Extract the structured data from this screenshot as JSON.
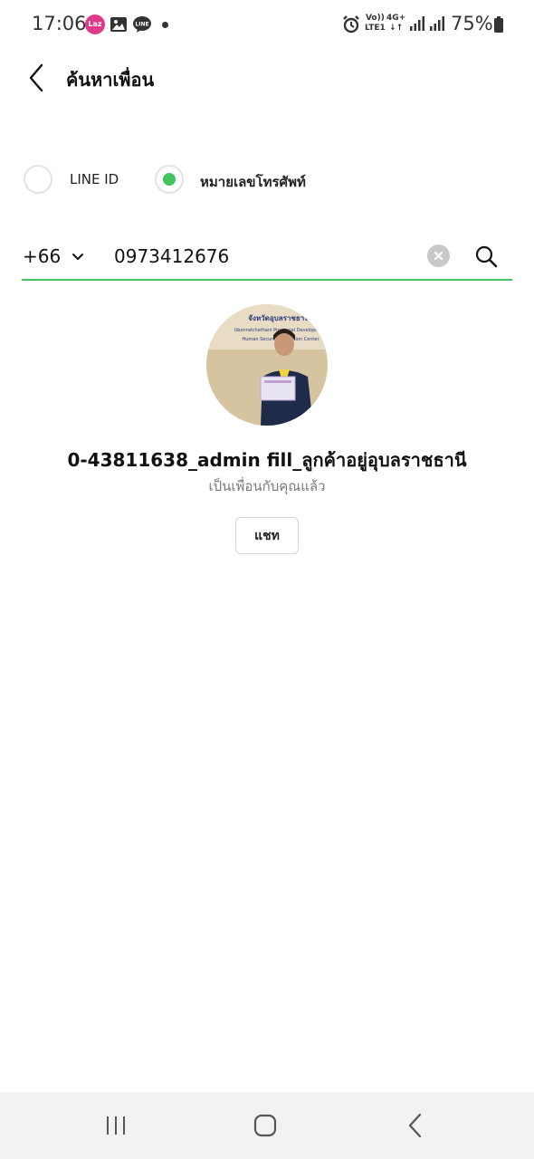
{
  "status_bar": {
    "time": "17:06",
    "notification_icons": [
      "lazada-icon",
      "gallery-icon",
      "line-icon",
      "dot-icon"
    ],
    "volte_label": "Vo))\nLTE1",
    "network_label": "4G+",
    "battery_percent": "75%"
  },
  "header": {
    "title": "ค้นหาเพื่อน"
  },
  "search_type": {
    "options": [
      {
        "label": "LINE ID",
        "selected": false
      },
      {
        "label": "หมายเลขโทรศัพท์",
        "selected": true
      }
    ]
  },
  "search": {
    "country_code": "+66",
    "phone_value": "0973412676"
  },
  "result": {
    "display_name": "0-43811638_admin fill_ลูกค้าอยู่อุบลราชธานี",
    "friend_status": "เป็นเพื่อนกับคุณแล้ว",
    "chat_button_label": "แชท",
    "avatar_banner_text": [
      "จังหวัดอุบลราชธานี",
      "Ubonratchathani Provincial Development",
      "Human Security Operation Center"
    ]
  },
  "colors": {
    "accent_green": "#44c45f",
    "nav_background": "#f2f2f2"
  }
}
